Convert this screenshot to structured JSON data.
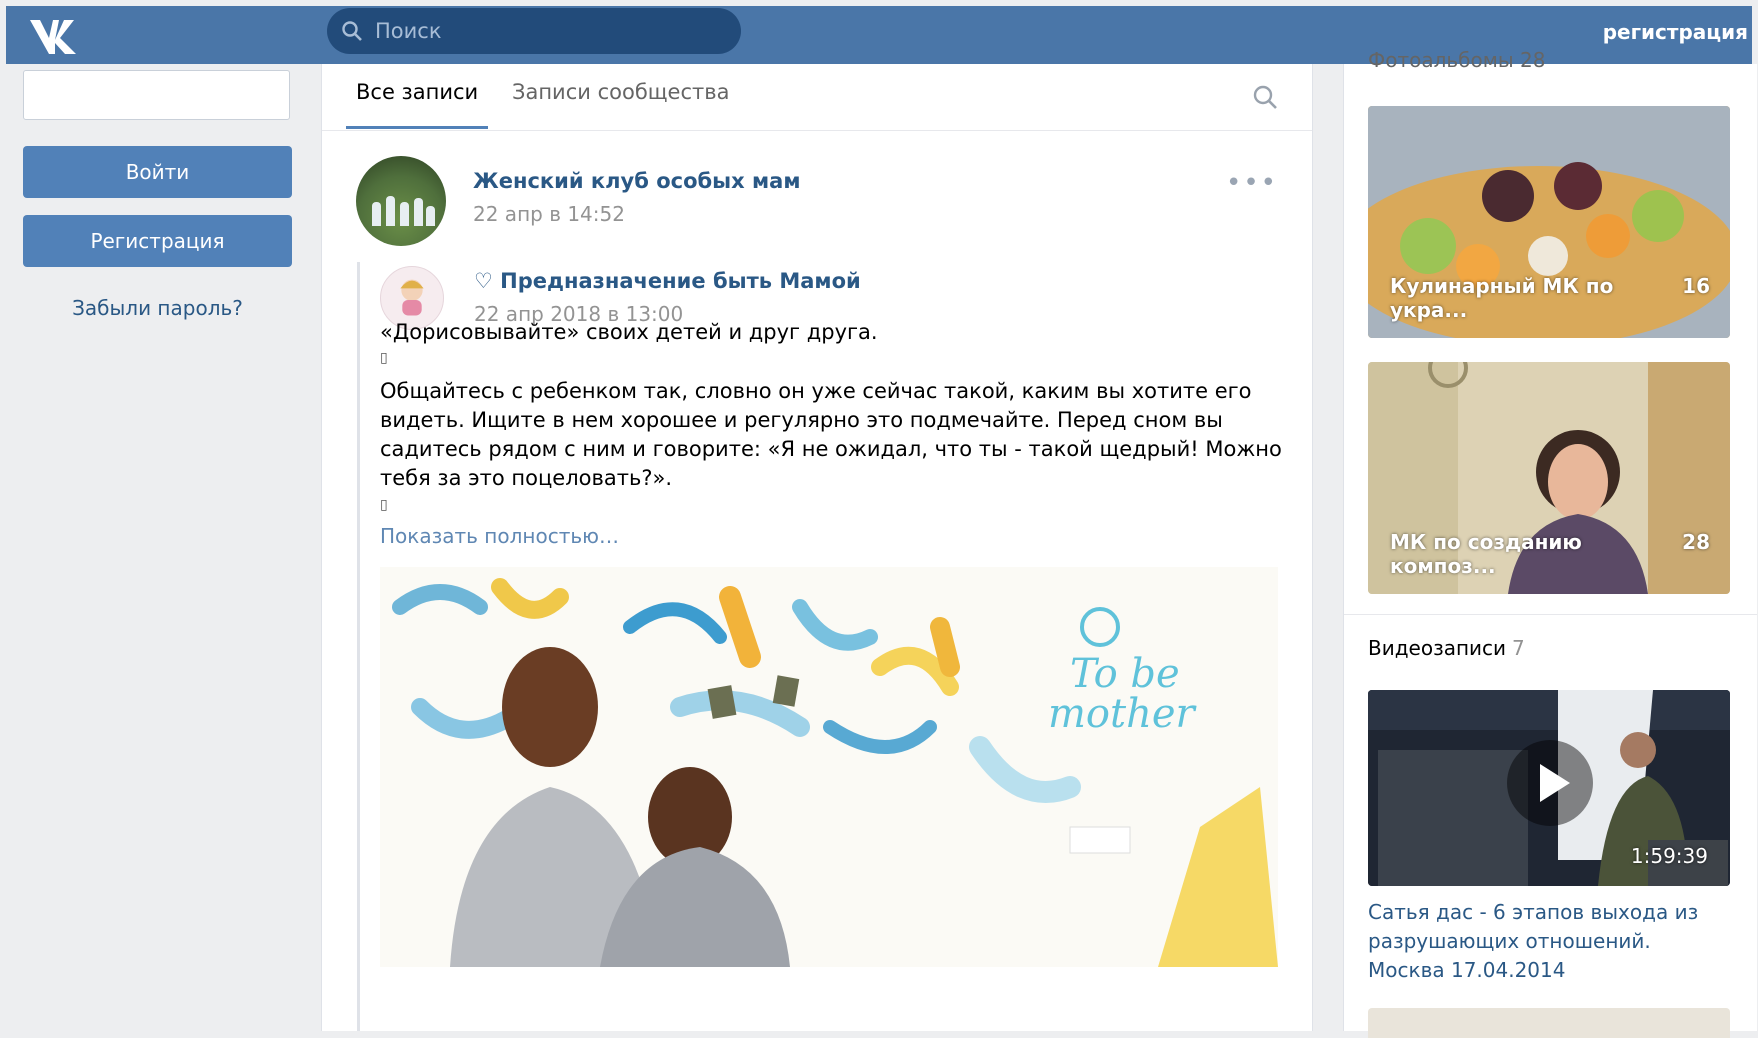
{
  "header": {
    "logo_label": "VK",
    "search_placeholder": "Поиск",
    "register_link": "регистрация"
  },
  "login": {
    "login_button": "Войти",
    "register_button": "Регистрация",
    "forgot_password": "Забыли пароль?"
  },
  "wall": {
    "tabs": [
      {
        "label": "Все записи",
        "active": true
      },
      {
        "label": "Записи сообщества",
        "active": false
      }
    ],
    "post": {
      "author": "Женский клуб особых мам",
      "date": "22 апр в 14:52",
      "repost": {
        "title": "♡ Предназначение быть Мамой",
        "date": "22 апр 2018 в 13:00",
        "text_lines": [
          "«Дорисовывайте» своих детей и друг друга.",
          "▯",
          "Общайтесь с ребенком так, словно он уже сейчас такой, каким вы хотите его",
          "видеть. Ищите в нем хорошее и регулярно это подмечайте. Перед сном вы",
          "садитесь рядом с ним и говорите: «Я не ожидал, что ты - такой щедрый! Можно",
          "тебя за это поцеловать?».",
          "▯"
        ],
        "show_more": "Показать полностью…",
        "photo_logo_line1": "To be",
        "photo_logo_line2": "mother"
      }
    }
  },
  "sidebar": {
    "albums_header": "Фотоальбомы 28",
    "albums": [
      {
        "title": "Кулинарный МК по укра...",
        "count": "16"
      },
      {
        "title": "МК по созданию композ...",
        "count": "28"
      }
    ],
    "videos_header": "Видеозаписи",
    "videos_count": "7",
    "video": {
      "duration": "1:59:39",
      "title": "Сатья дас - 6 этапов выхода из разрушающих отношений. Москва 17.04.2014"
    }
  },
  "colors": {
    "brand": "#4a76a8",
    "button": "#5181b8",
    "link": "#2a5885"
  }
}
